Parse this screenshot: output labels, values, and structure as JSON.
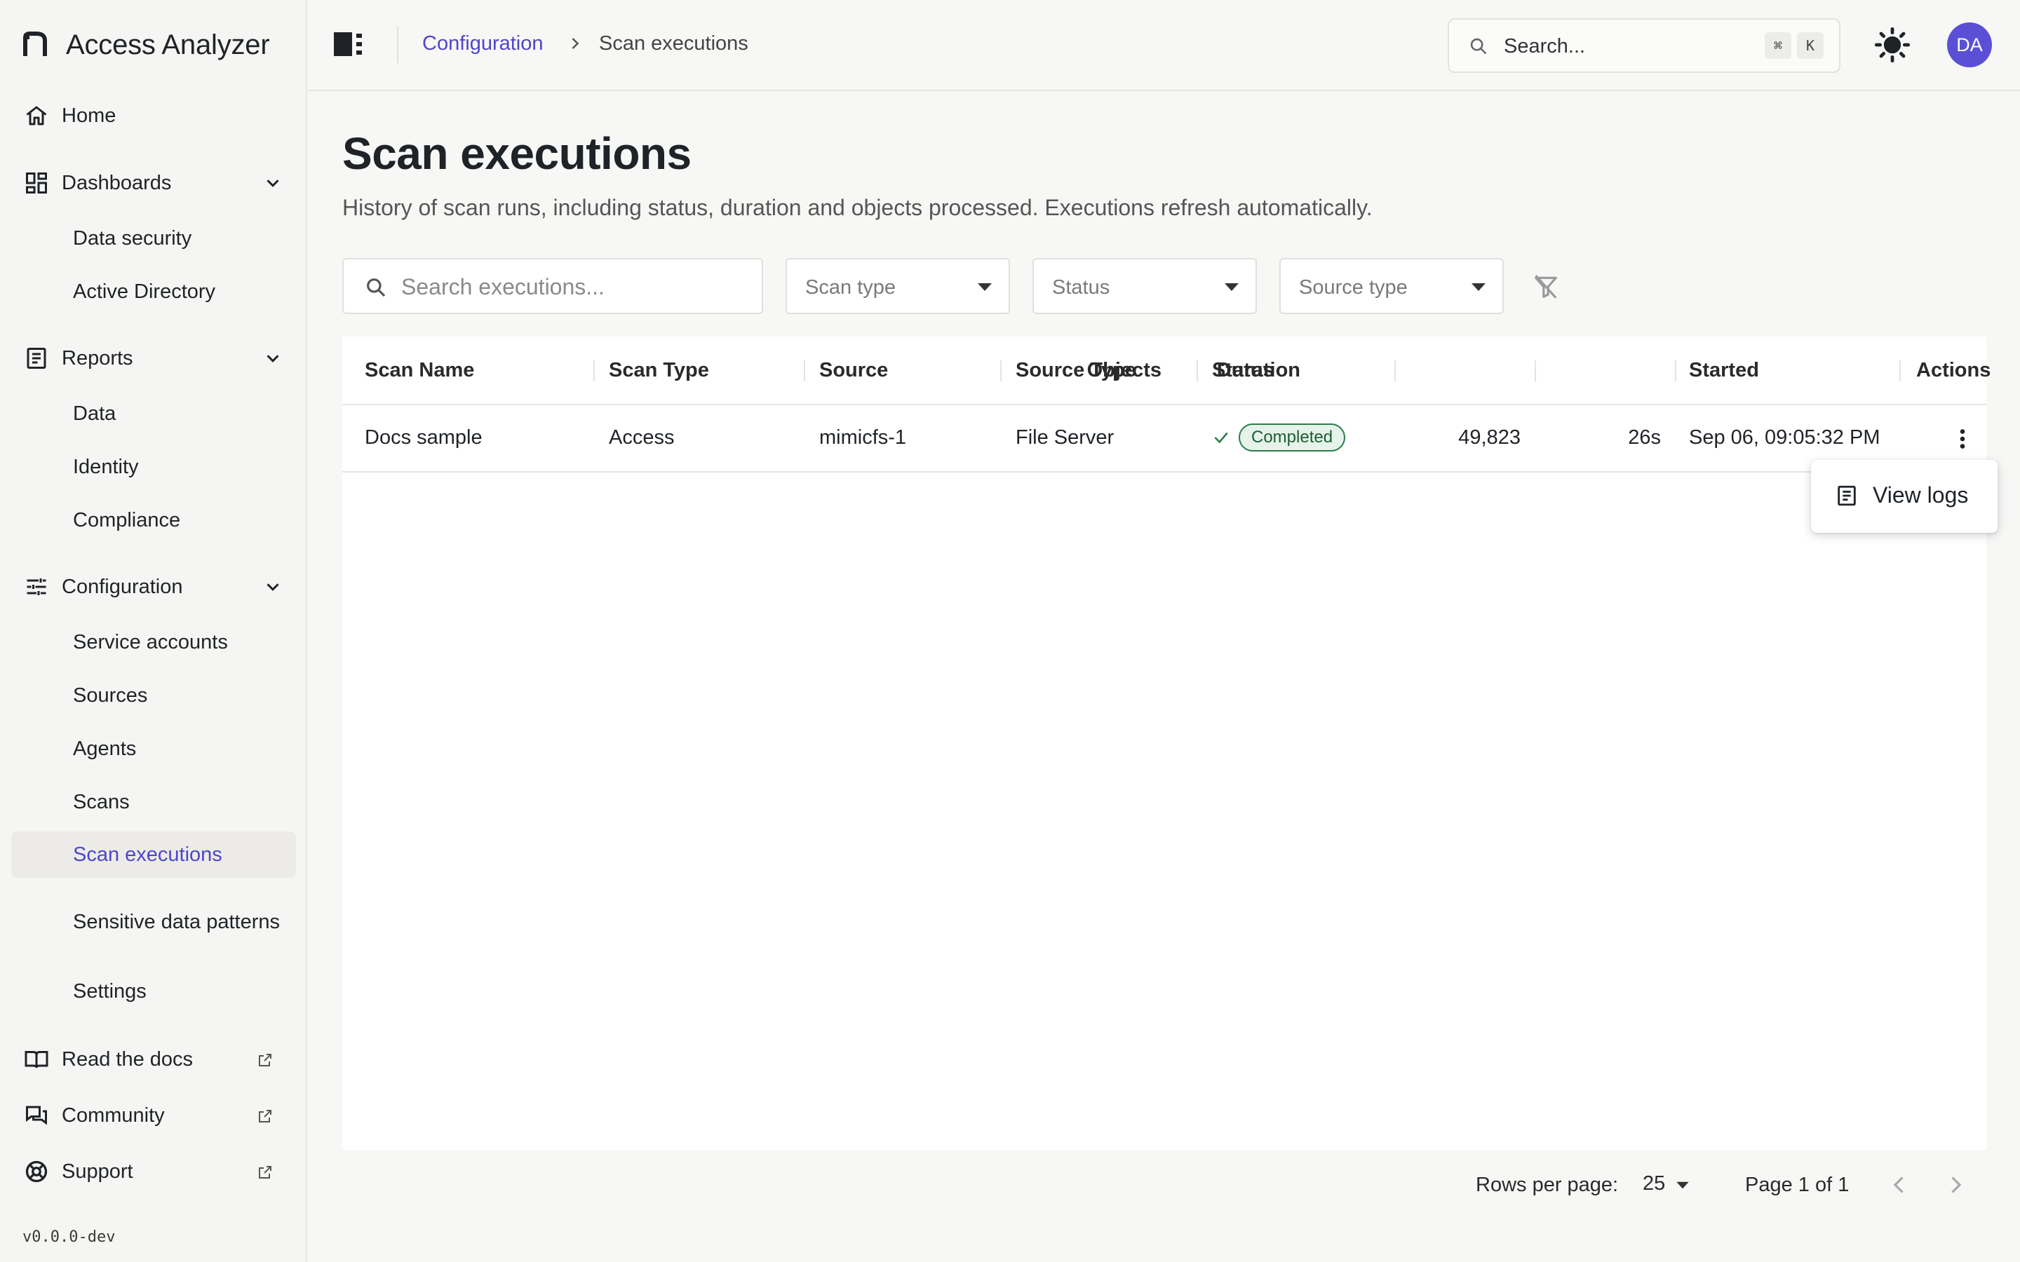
{
  "app": {
    "name": "Access Analyzer",
    "version": "v0.0.0-dev"
  },
  "sidebar": {
    "home": "Home",
    "dashboards": {
      "label": "Dashboards",
      "items": [
        "Data security",
        "Active Directory"
      ]
    },
    "reports": {
      "label": "Reports",
      "items": [
        "Data",
        "Identity",
        "Compliance"
      ]
    },
    "configuration": {
      "label": "Configuration",
      "items": [
        "Service accounts",
        "Sources",
        "Agents",
        "Scans",
        "Scan executions",
        "Sensitive data patterns",
        "Settings"
      ],
      "active": "Scan executions"
    },
    "links": [
      "Read the docs",
      "Community",
      "Support"
    ]
  },
  "topbar": {
    "breadcrumb_parent": "Configuration",
    "breadcrumb_current": "Scan executions",
    "search_placeholder": "Search...",
    "shortcut_keys": [
      "⌘",
      "K"
    ],
    "avatar_initials": "DA"
  },
  "page": {
    "title": "Scan executions",
    "subtitle": "History of scan runs, including status, duration and objects processed. Executions refresh automatically."
  },
  "filters": {
    "search_placeholder": "Search executions...",
    "scan_type": "Scan type",
    "status": "Status",
    "source_type": "Source type"
  },
  "table": {
    "columns": [
      "Scan Name",
      "Scan Type",
      "Source",
      "Source Type",
      "Status",
      "Objects",
      "Duration",
      "Started",
      "Actions"
    ],
    "rows": [
      {
        "scan_name": "Docs sample",
        "scan_type": "Access",
        "source": "mimicfs-1",
        "source_type": "File Server",
        "status": "Completed",
        "objects": "49,823",
        "duration": "26s",
        "started": "Sep 06, 09:05:32 PM"
      }
    ]
  },
  "row_menu": {
    "items": [
      "View logs"
    ]
  },
  "pagination": {
    "rows_per_page_label": "Rows per page:",
    "rows_per_page": "25",
    "page_info": "Page 1 of 1"
  },
  "colors": {
    "accent": "#4f46c8",
    "avatar": "#5b4fd6",
    "status_success": "#2e7d4b",
    "status_success_bg": "#e5f3ea"
  }
}
